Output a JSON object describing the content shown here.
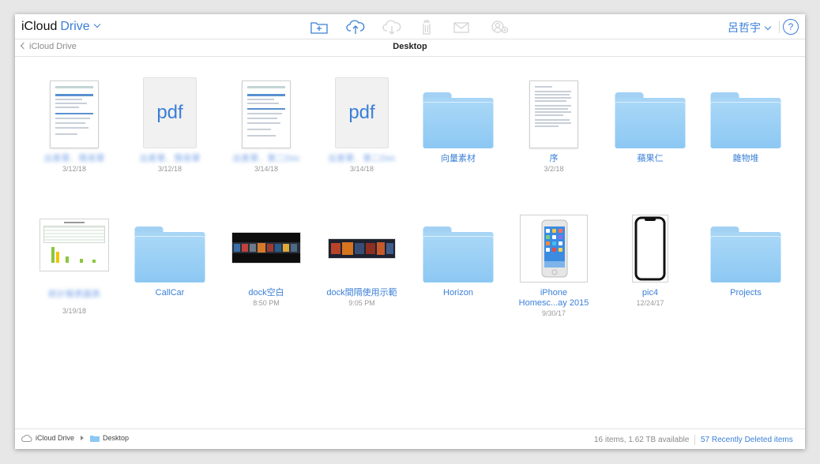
{
  "header": {
    "brand": "iCloud",
    "app": "Drive",
    "user_name": "呂哲宇",
    "help_label": "?"
  },
  "toolbar": {
    "new_folder_icon": "folder-plus-icon",
    "upload_icon": "cloud-upload-icon",
    "download_icon": "cloud-download-icon",
    "delete_icon": "trash-icon",
    "mail_icon": "envelope-icon",
    "share_icon": "share-person-icon",
    "accent_color": "#3a7fd8",
    "disabled_color": "#d4d4d4"
  },
  "nav": {
    "back_label": "iCloud Drive",
    "title": "Desktop"
  },
  "items": [
    {
      "kind": "doc-form",
      "label": "出差單．簡易單",
      "date": "3/12/18",
      "blurred": true
    },
    {
      "kind": "pdf",
      "label": "出差單．簡易單",
      "date": "3/12/18",
      "blurred": true,
      "icon_text": "pdf"
    },
    {
      "kind": "doc-form",
      "label": "出差單．第二Doc",
      "date": "3/14/18",
      "blurred": true
    },
    {
      "kind": "pdf",
      "label": "出差單．第二Doc",
      "date": "3/14/18",
      "blurred": true,
      "icon_text": "pdf"
    },
    {
      "kind": "folder",
      "label": "向量素材",
      "date": ""
    },
    {
      "kind": "doc-text",
      "label": "序",
      "date": "3/2/18"
    },
    {
      "kind": "folder",
      "label": "蘋果仁",
      "date": ""
    },
    {
      "kind": "folder",
      "label": "雜物堆",
      "date": ""
    },
    {
      "kind": "chart-doc",
      "label": "統計報表圖表",
      "date": "3/19/18",
      "blurred": true
    },
    {
      "kind": "folder",
      "label": "CallCar",
      "date": ""
    },
    {
      "kind": "strip",
      "label": "dock空白",
      "date": "8:50 PM"
    },
    {
      "kind": "strip2",
      "label": "dock間隔使用示範",
      "date": "9:05 PM"
    },
    {
      "kind": "folder",
      "label": "Horizon",
      "date": ""
    },
    {
      "kind": "phone",
      "label": "iPhone",
      "label2": "Homesc...ay 2015",
      "date": "9/30/17"
    },
    {
      "kind": "pic4",
      "label": "pic4",
      "date": "12/24/17"
    },
    {
      "kind": "folder",
      "label": "Projects",
      "date": ""
    }
  ],
  "footer": {
    "crumb_root": "iCloud Drive",
    "crumb_current": "Desktop",
    "status": "16 items, 1.62 TB available",
    "recently_deleted": "57 Recently Deleted items"
  }
}
